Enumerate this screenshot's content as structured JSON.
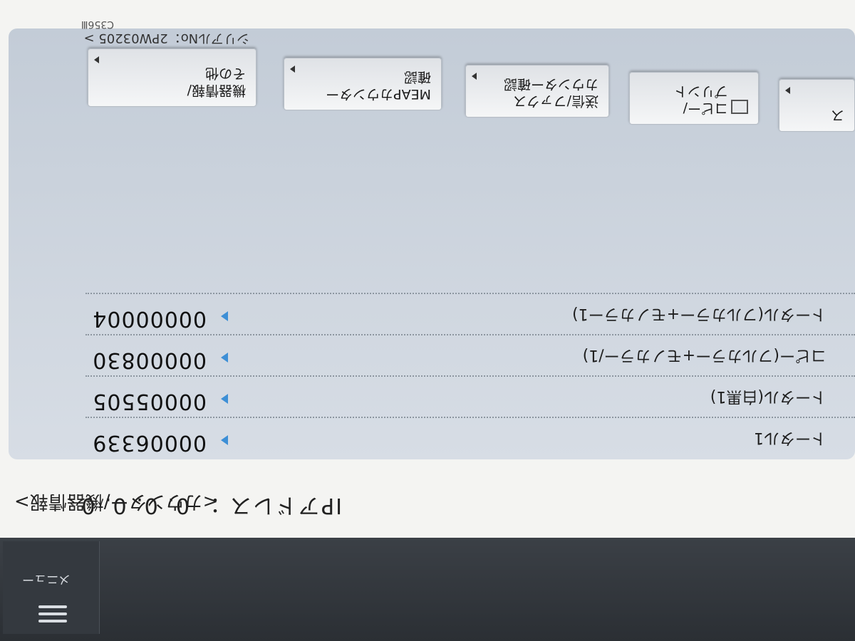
{
  "breadcrumb": "<カウンター/機器情報>",
  "ip": {
    "label": "IPアドレス",
    "separator": "：",
    "value": "0. 0. 0. 0"
  },
  "counters": [
    {
      "num": "",
      "name": "トータル1",
      "value": "00006339"
    },
    {
      "num": "",
      "name": "トータル(白黒1)",
      "value": "00005505"
    },
    {
      "num": "",
      "name": "コピー(フルカラー+モノカラー/1)",
      "value": "00000830"
    },
    {
      "num": "",
      "name": "トータル(フルカラー+モノカラー1)",
      "value": "00000004"
    }
  ],
  "buttons": [
    {
      "label": "機器情報/\nその他"
    },
    {
      "label": "MEAPカウンター\n確認"
    },
    {
      "label": "送信/ファクス\nカウンター確認"
    },
    {
      "label": "コピー/\nプリント"
    },
    {
      "label": "ス"
    }
  ],
  "serial_text": "シリアルNo：2PW03205 >",
  "serial_sub": "C356Ⅲ",
  "menu": {
    "label": "メニュー"
  },
  "colors": {
    "accent_arrow": "#3d8fd6",
    "card": "#c8d0da"
  }
}
